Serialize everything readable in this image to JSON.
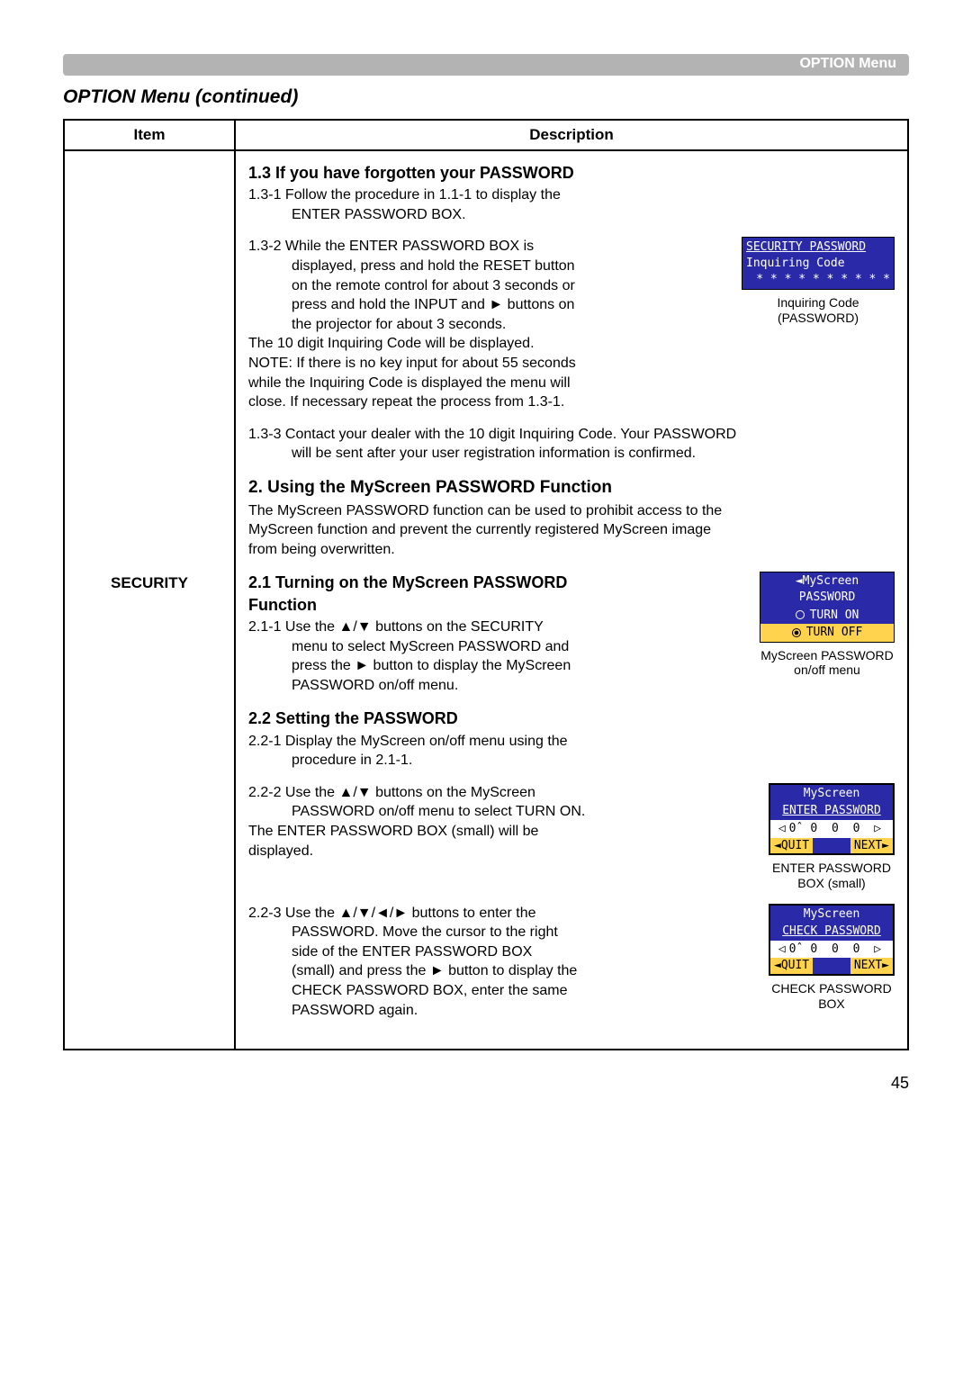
{
  "header": {
    "right_label": "OPTION Menu"
  },
  "title": "OPTION Menu (continued)",
  "table": {
    "headers": {
      "item": "Item",
      "description": "Description"
    },
    "row_item": "SECURITY"
  },
  "s1_3": {
    "heading": "1.3 If you have forgotten your PASSWORD",
    "p1": "1.3-1 Follow the procedure in 1.1-1 to display the",
    "p1b": "ENTER PASSWORD BOX.",
    "p2_l1": "1.3-2 While the ENTER PASSWORD BOX is",
    "p2_l2": "displayed, press and hold the RESET button",
    "p2_l3": "on the remote control for about 3 seconds or",
    "p2_l4": "press and hold the INPUT and ► buttons on",
    "p2_l5": "the projector for about 3 seconds.",
    "p2_l6": "The 10 digit Inquiring Code will be displayed.",
    "p2_l7": "NOTE: If there is no key input for about 55 seconds",
    "p2_l8": "while the Inquiring Code is displayed the menu will",
    "p2_l9": "close. If necessary repeat the process from 1.3-1.",
    "p3_l1": "1.3-3 Contact your dealer with the 10 digit Inquiring Code. Your PASSWORD",
    "p3_l2": "will be sent after your user registration information is confirmed.",
    "fig1": {
      "title": "SECURITY PASSWORD",
      "sub": "Inquiring Code",
      "code": "* *  * * * *  * * * *",
      "cap_l1": "Inquiring Code",
      "cap_l2": "(PASSWORD)"
    }
  },
  "s2": {
    "heading": "2. Using the MyScreen PASSWORD Function",
    "intro_l1": "The MyScreen PASSWORD function can be used to prohibit access to the",
    "intro_l2": "MyScreen function and prevent the currently registered MyScreen image",
    "intro_l3": "from being overwritten."
  },
  "s2_1": {
    "heading_l1": "2.1 Turning on the MyScreen PASSWORD",
    "heading_l2": "Function",
    "p1_l1": "2.1-1 Use the ▲/▼ buttons on the SECURITY",
    "p1_l2": "menu to select MyScreen PASSWORD and",
    "p1_l3": "press the ► button to display the MyScreen",
    "p1_l4": "PASSWORD on/off menu.",
    "fig": {
      "title": "◄MyScreen PASSWORD",
      "opt_on": "TURN ON",
      "opt_off": "TURN OFF",
      "cap_l1": "MyScreen PASSWORD",
      "cap_l2": "on/off menu"
    }
  },
  "s2_2": {
    "heading": "2.2 Setting the PASSWORD",
    "p1_l1": "2.2-1 Display the MyScreen on/off menu using the",
    "p1_l2": "procedure in 2.1-1.",
    "p2_l1": "2.2-2 Use the ▲/▼ buttons on the MyScreen",
    "p2_l2": "PASSWORD on/off menu to select TURN ON.",
    "p2_l3": "The ENTER PASSWORD BOX (small) will be",
    "p2_l4": "displayed.",
    "p3_l1": "2.2-3 Use the ▲/▼/◄/► buttons to enter the",
    "p3_l2": "PASSWORD. Move the cursor to the right",
    "p3_l3": "side of the ENTER PASSWORD BOX",
    "p3_l4": "(small) and press the ► button to display the",
    "p3_l5": "CHECK PASSWORD BOX, enter the same",
    "p3_l6": "PASSWORD again.",
    "fig_enter": {
      "t1": "MyScreen",
      "t2": "ENTER PASSWORD",
      "digits": "◁0̂  0  0  0 ▷",
      "quit": "◄QUIT",
      "next": "NEXT►",
      "cap_l1": "ENTER PASSWORD",
      "cap_l2": "BOX (small)"
    },
    "fig_check": {
      "t1": "MyScreen",
      "t2": "CHECK PASSWORD",
      "digits": "◁0̂  0  0  0 ▷",
      "quit": "◄QUIT",
      "next": "NEXT►",
      "cap_l1": "CHECK PASSWORD",
      "cap_l2": "BOX"
    }
  },
  "page_number": "45"
}
